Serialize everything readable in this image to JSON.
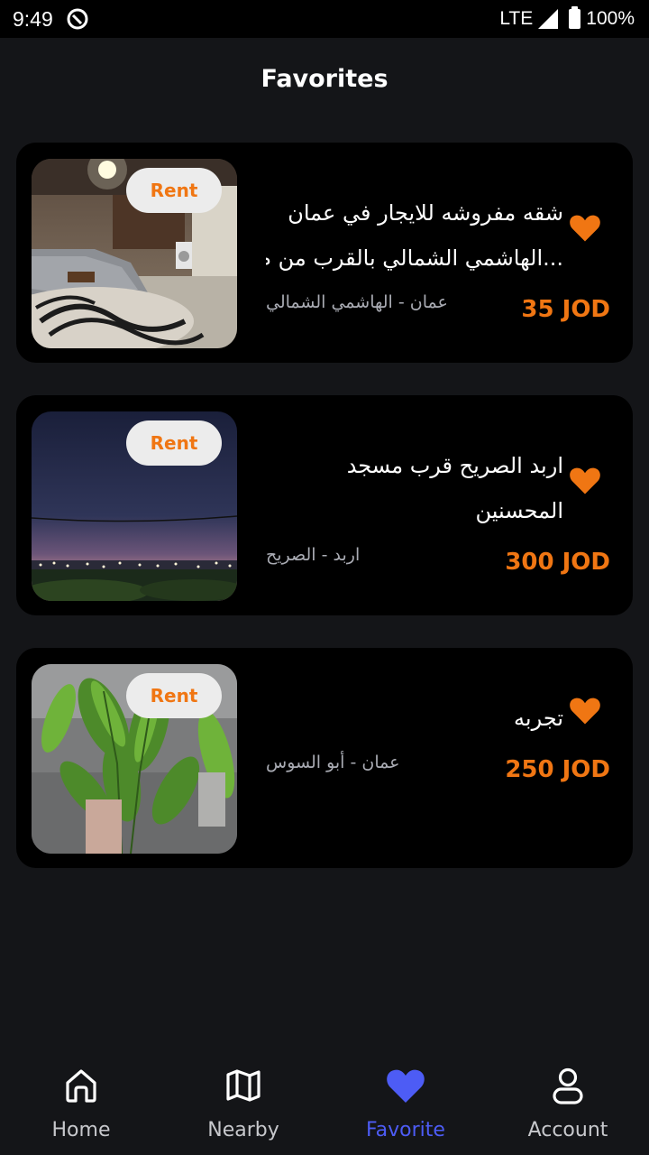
{
  "status_bar": {
    "time": "9:49",
    "network": "LTE",
    "battery": "100%"
  },
  "page": {
    "title": "Favorites"
  },
  "colors": {
    "accent_orange": "#f07613",
    "active_nav": "#4d5cf5",
    "background": "#141518",
    "card": "#000000"
  },
  "favorites": [
    {
      "badge": "Rent",
      "title_line1": "شقه مفروشه للايجار في عمان",
      "title_line2": "...الهاشمي الشمالي بالقرب من م",
      "location": "عمان - الهاشمي الشمالي",
      "price": "35 JOD",
      "icon": "heart-filled-icon",
      "image": "furnished-living-room-photo"
    },
    {
      "badge": "Rent",
      "title_line1": "اربد الصريح قرب مسجد",
      "title_line2": "المحسنين",
      "location": "اربد - الصريح",
      "price": "300 JOD",
      "icon": "heart-filled-icon",
      "image": "night-sky-city-lights-photo"
    },
    {
      "badge": "Rent",
      "title_line1": "تجربه",
      "location": "عمان - أبو السوس",
      "price": "250 JOD",
      "icon": "heart-filled-icon",
      "image": "potted-plant-photo"
    }
  ],
  "bottom_nav": [
    {
      "label": "Home",
      "icon": "home-icon",
      "active": false
    },
    {
      "label": "Nearby",
      "icon": "map-icon",
      "active": false
    },
    {
      "label": "Favorite",
      "icon": "heart-icon",
      "active": true
    },
    {
      "label": "Account",
      "icon": "user-icon",
      "active": false
    }
  ]
}
